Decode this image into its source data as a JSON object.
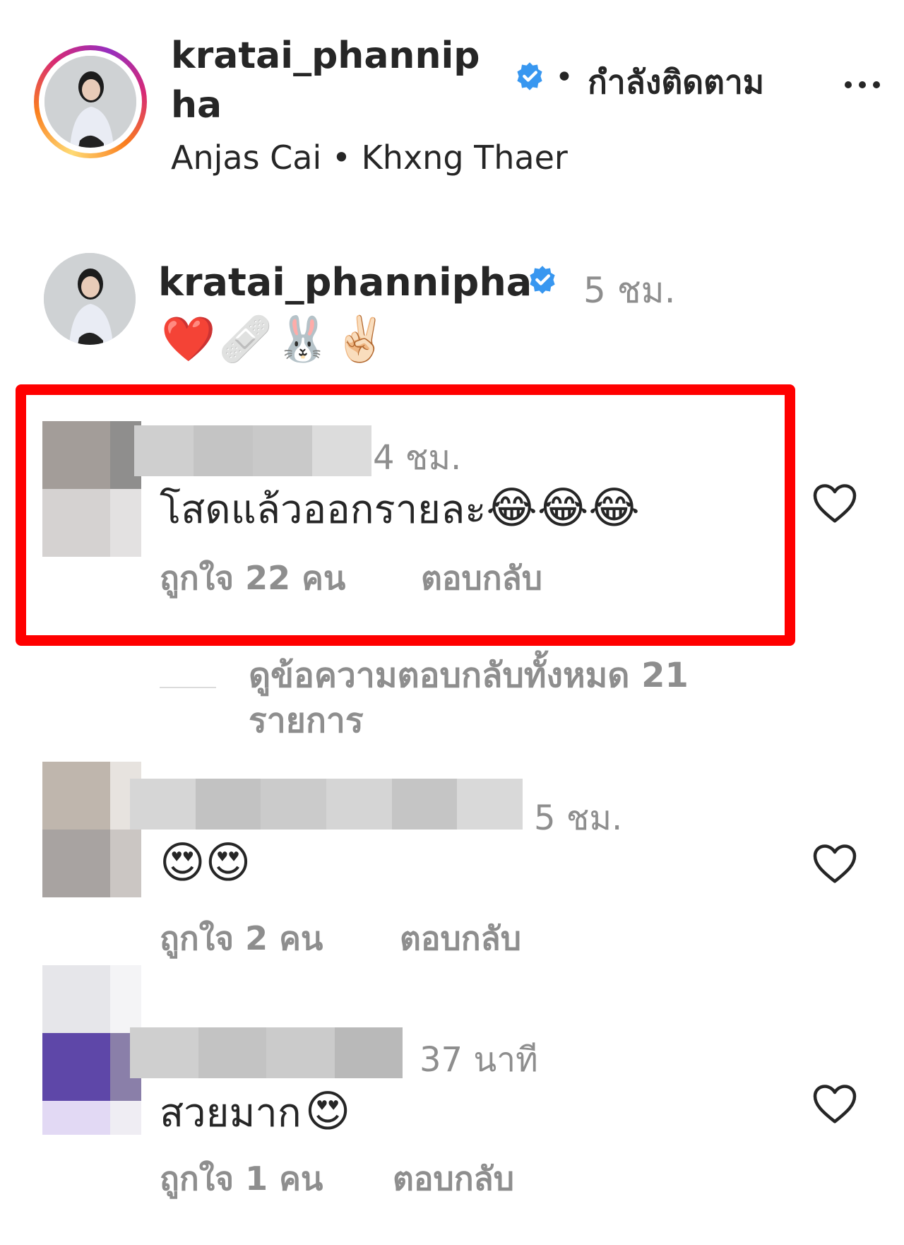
{
  "post_header": {
    "username": "kratai_phannipha",
    "dot": "•",
    "follow_status": "กำลังติดตาม",
    "location": "Anjas Cai • Khxng Thaer"
  },
  "caption": {
    "username": "kratai_phannipha",
    "time": "5 ชม.",
    "emoji": "❤️🩹🐰✌🏻"
  },
  "comments": [
    {
      "time": "4 ชม.",
      "text": "โสดแล้วออกรายละ",
      "emoji": "😂😂😂",
      "likes": "ถูกใจ 22 คน",
      "reply": "ตอบกลับ",
      "view_replies": "ดูข้อความตอบกลับทั้งหมด 21 รายการ"
    },
    {
      "time": "5 ชม.",
      "text": "",
      "emoji": "😍😍",
      "likes": "ถูกใจ 2 คน",
      "reply": "ตอบกลับ"
    },
    {
      "time": "37 นาที",
      "text": "สวยมาก",
      "emoji": "😍",
      "likes": "ถูกใจ 1 คน",
      "reply": "ตอบกลับ"
    }
  ],
  "colors": {
    "verified": "#3897f0",
    "highlight_border": "#ff0000",
    "secondary_text": "#8e8e8e",
    "primary_text": "#262626"
  }
}
